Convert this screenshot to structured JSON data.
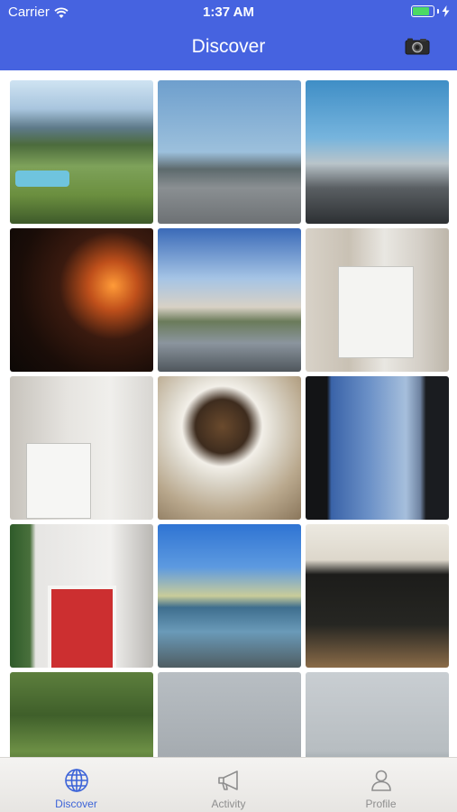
{
  "status_bar": {
    "carrier": "Carrier",
    "time": "1:37 AM",
    "battery_level": 0.8,
    "battery_color": "#4cd964"
  },
  "nav": {
    "title": "Discover",
    "right_icon": "camera-icon",
    "background_color": "#4663e0"
  },
  "photos": [
    {
      "subject": "pool-mountain-photo"
    },
    {
      "subject": "highway-photo"
    },
    {
      "subject": "toll-booth-photo"
    },
    {
      "subject": "fireplace-photo"
    },
    {
      "subject": "plaza-fountain-photo"
    },
    {
      "subject": "air-conditioner-photo"
    },
    {
      "subject": "air-conditioner-room-photo"
    },
    {
      "subject": "coffee-mug-photo"
    },
    {
      "subject": "airplane-window-photo"
    },
    {
      "subject": "red-door-photo"
    },
    {
      "subject": "river-photo"
    },
    {
      "subject": "chalkboard-menu-photo"
    },
    {
      "subject": "jungle-photo"
    },
    {
      "subject": "cloudy-sky-photo"
    },
    {
      "subject": "seaside-photo"
    }
  ],
  "tabbar": {
    "tabs": [
      {
        "label": "Discover",
        "icon": "globe-icon",
        "active": true
      },
      {
        "label": "Activity",
        "icon": "megaphone-icon",
        "active": false
      },
      {
        "label": "Profile",
        "icon": "person-icon",
        "active": false
      }
    ],
    "active_color": "#3d64d8",
    "inactive_color": "#8e8e8e"
  }
}
